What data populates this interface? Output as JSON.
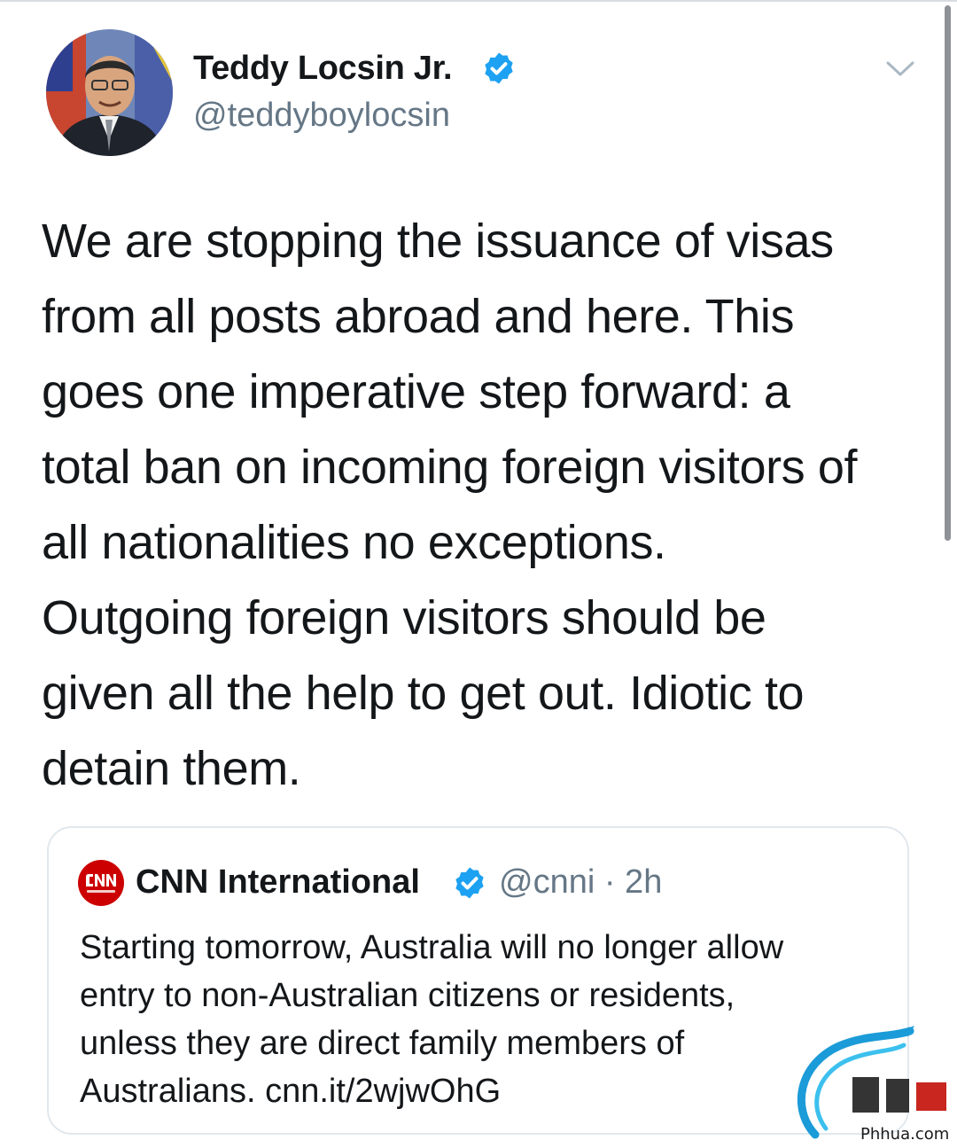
{
  "tweet": {
    "author": {
      "name": "Teddy Locsin Jr.",
      "handle": "@teddyboylocsin",
      "verified": true
    },
    "text_lines": [
      "We are stopping the issuance of visas",
      "from all posts abroad and here. This",
      "goes one imperative step forward: a",
      "total ban on incoming foreign visitors of",
      "all nationalities no exceptions.",
      "Outgoing foreign visitors should be",
      "given all the help to get out. Idiotic to",
      "detain them."
    ],
    "menu_icon": "chevron-down-icon"
  },
  "quoted_tweet": {
    "author": {
      "name": "CNN International",
      "handle_time": "@cnni · 2h",
      "verified": true,
      "logo": "cnn-logo"
    },
    "text_lines": [
      "Starting tomorrow, Australia will no longer allow",
      "entry to non-Australian citizens or residents,",
      "unless they are direct family members of",
      "Australians. cnn.it/2wjwOhG"
    ]
  },
  "watermark": {
    "site": "Phhua.com"
  },
  "colors": {
    "text_primary": "#14171a",
    "text_secondary": "#657786",
    "verified_blue": "#1da1f2",
    "card_border": "#e1e8ed",
    "cnn_red": "#cc0000"
  }
}
